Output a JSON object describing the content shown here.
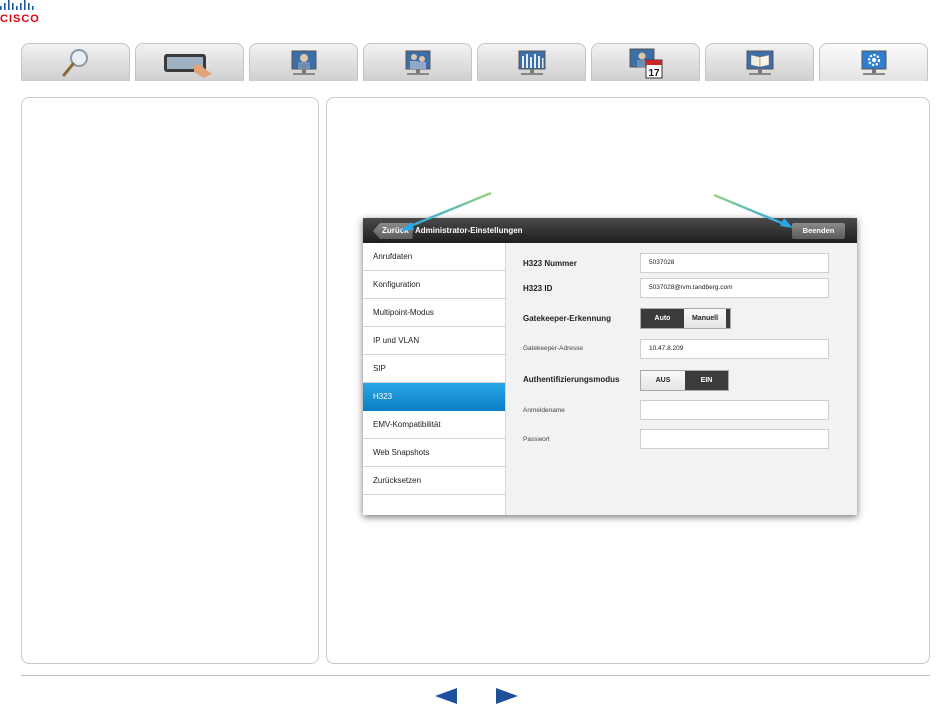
{
  "brand": {
    "logo_text": "CISCO"
  },
  "nav_tabs": [
    {
      "id": "search",
      "icon": "magnifier-icon"
    },
    {
      "id": "touch",
      "icon": "touch-panel-icon"
    },
    {
      "id": "person",
      "icon": "person-screen-icon"
    },
    {
      "id": "multipoint",
      "icon": "multipoint-screen-icon"
    },
    {
      "id": "audience",
      "icon": "audience-screen-icon"
    },
    {
      "id": "calendar",
      "icon": "calendar-screen-icon",
      "calendar_day": "17"
    },
    {
      "id": "book",
      "icon": "book-screen-icon"
    },
    {
      "id": "settings",
      "icon": "gear-screen-icon",
      "active": true
    }
  ],
  "window": {
    "back_label": "Zurück",
    "title": "Administrator-Einstellungen",
    "done_label": "Beenden",
    "menu": [
      {
        "label": "Anrufdaten"
      },
      {
        "label": "Konfiguration"
      },
      {
        "label": "Multipoint-Modus"
      },
      {
        "label": "IP und VLAN"
      },
      {
        "label": "SIP"
      },
      {
        "label": "H323",
        "active": true
      },
      {
        "label": "EMV-Kompatibilität"
      },
      {
        "label": "Web Snapshots"
      },
      {
        "label": "Zurücksetzen"
      }
    ],
    "form": {
      "h323_number_label": "H323 Nummer",
      "h323_number_value": "5037028",
      "h323_id_label": "H323 ID",
      "h323_id_value": "5037028@ivm.tandberg.com",
      "gatekeeper_discovery_label": "Gatekeeper-Erkennung",
      "gatekeeper_auto": "Auto",
      "gatekeeper_manual": "Manuell",
      "gatekeeper_address_label": "Gatekeeper-Adresse",
      "gatekeeper_address_value": "10.47.8.209",
      "auth_mode_label": "Authentifizierungsmodus",
      "auth_off": "AUS",
      "auth_on": "EIN",
      "login_name_label": "Anmeldename",
      "login_name_value": "",
      "password_label": "Passwort",
      "password_value": ""
    }
  },
  "colors": {
    "accent_blue": "#1596dc",
    "arrow_green": "#7cc576",
    "arrow_blue": "#2aa6e6",
    "nav_arrow": "#1f4e9a"
  }
}
